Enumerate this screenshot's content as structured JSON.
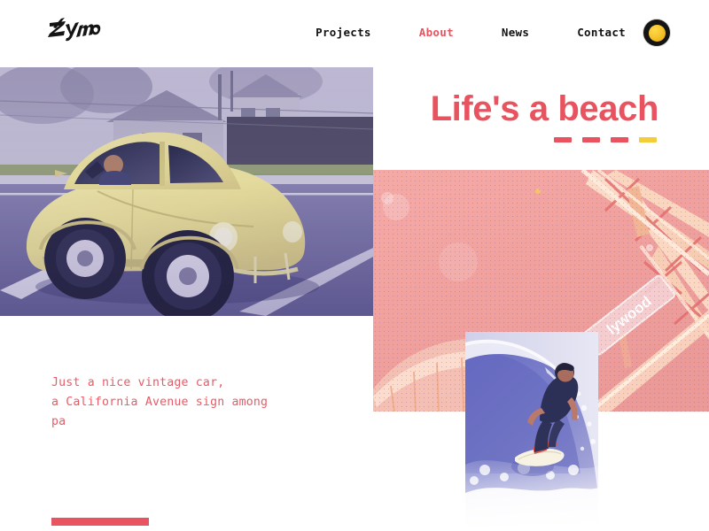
{
  "site": {
    "logo_text": "Zymo",
    "logo_icon": "script-wordmark-logo"
  },
  "header": {
    "nav": [
      {
        "label": "Projects",
        "active": false
      },
      {
        "label": "About",
        "active": true
      },
      {
        "label": "News",
        "active": false
      },
      {
        "label": "Contact",
        "active": false
      }
    ],
    "badge_icon": "yellow-dot-badge-icon"
  },
  "hero": {
    "headline": "Life's a beach",
    "dashes": [
      "#e8535f",
      "#e8535f",
      "#e8535f",
      "#f4cd3a"
    ]
  },
  "caption": {
    "line1": "Just a nice vintage car,",
    "line2": "a California Avenue sign among",
    "line3": "pa"
  },
  "media": {
    "car_photo": {
      "alt": "Yellow vintage Volkswagen Beetle driving down a suburban street",
      "icon": "vintage-car-photo"
    },
    "pink_panel": {
      "alt": "Pink duotone photo of a wooden rollercoaster and a Hollywood street sign",
      "icon": "rollercoaster-duotone-photo",
      "sign_text": "lywood"
    },
    "surf_photo": {
      "alt": "Surfer riding a breaking blue wave",
      "icon": "surfer-photo"
    }
  },
  "colors": {
    "accent_pink": "#e8535f",
    "accent_yellow": "#f4cd3a",
    "panel_pink": "#f2a6a3",
    "ink": "#111111",
    "background": "#ffffff"
  },
  "decor": {
    "bottom_bar": "accent-rule"
  }
}
